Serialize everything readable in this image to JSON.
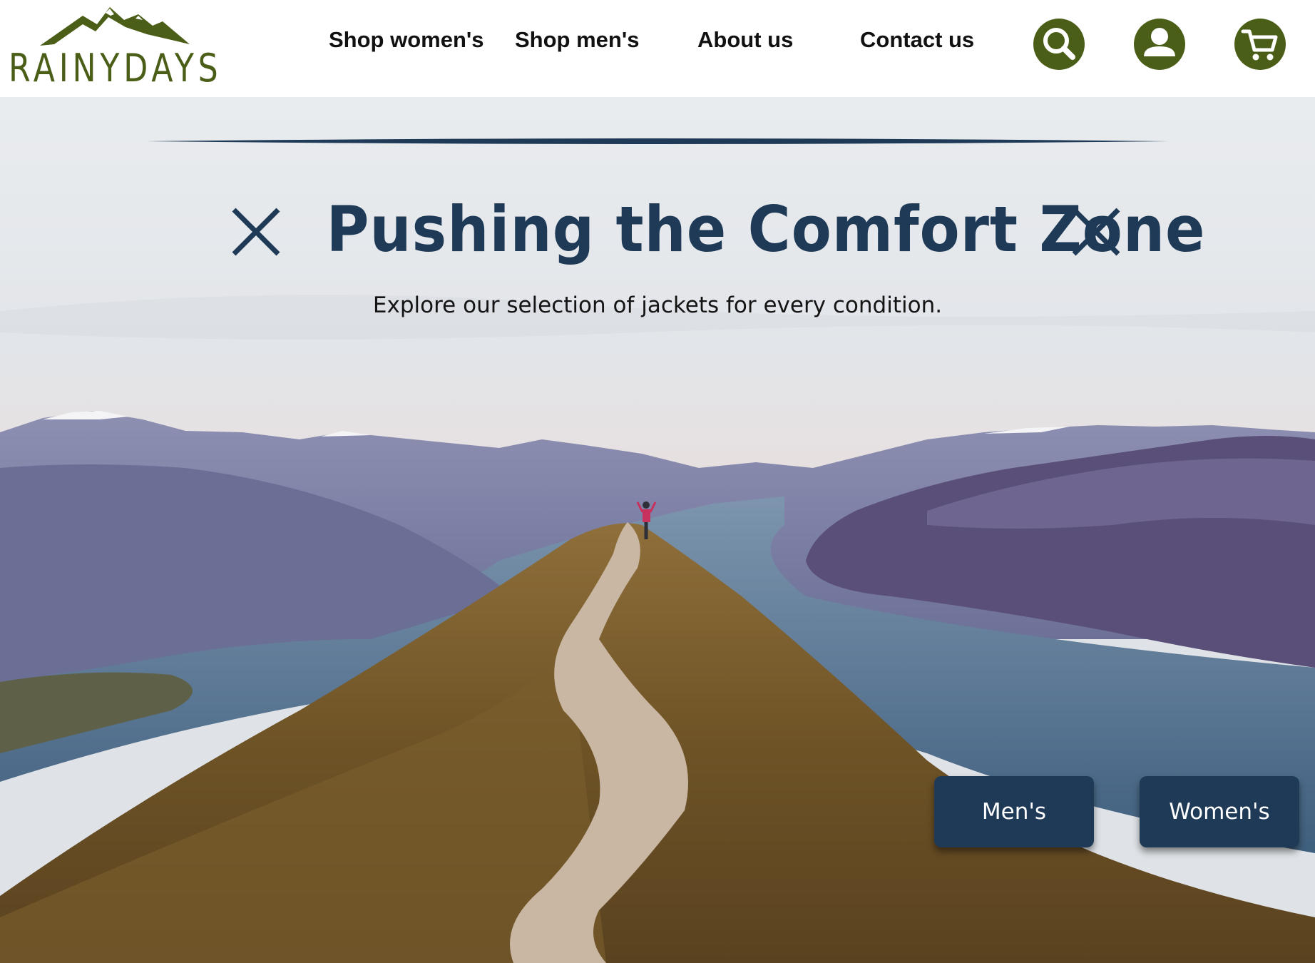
{
  "brand": {
    "name": "RAINYDAYS",
    "logo_icon": "mountain-logo-icon",
    "color": "#4a5e18"
  },
  "nav": {
    "items": [
      {
        "label": "Shop women's"
      },
      {
        "label": "Shop men's"
      },
      {
        "label": "About us"
      },
      {
        "label": "Contact us"
      }
    ],
    "icons": [
      {
        "name": "search-icon"
      },
      {
        "name": "account-icon"
      },
      {
        "name": "cart-icon"
      }
    ]
  },
  "hero": {
    "title": "Pushing the Comfort Zone",
    "subtitle": "Explore our selection of jackets for every condition.",
    "title_color": "#1f3a57",
    "background": "mountain ridge trail above lake",
    "buttons": [
      {
        "label": "Men's"
      },
      {
        "label": "Women's"
      }
    ],
    "button_color": "#1f3a57"
  }
}
